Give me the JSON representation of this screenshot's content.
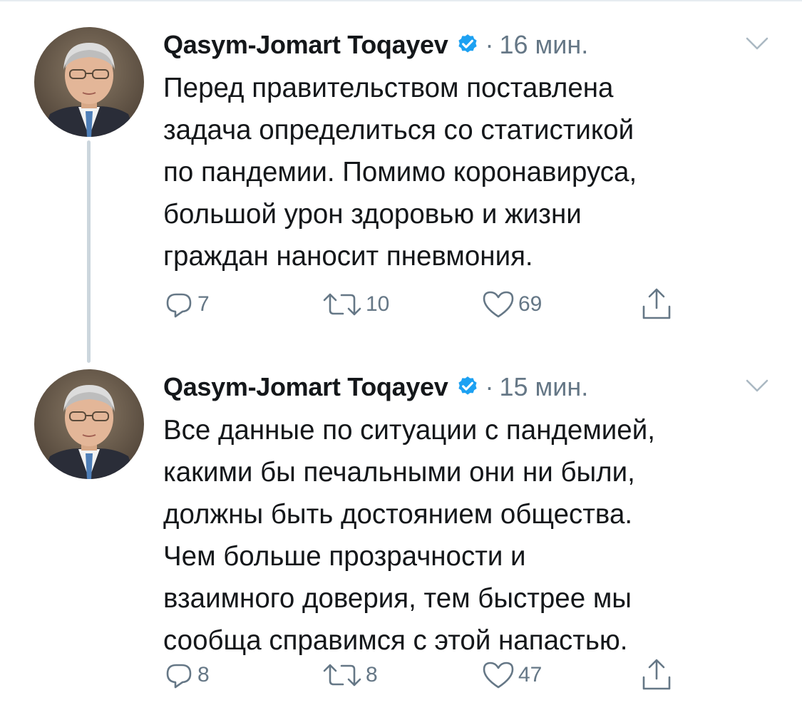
{
  "colors": {
    "text": "#14171a",
    "secondary": "#657786",
    "verified": "#1da1f2",
    "thread_line": "#ccd6dd"
  },
  "tweets": [
    {
      "author_name": "Qasym-Jomart Toqayev",
      "verified_icon": "verified-badge-icon",
      "separator": "·",
      "time": "16 мин.",
      "text": "Перед правительством поставлена\nзадача определиться со статистикой\nпо пандемии. Помимо коронавируса,\nбольшой урон здоровью и жизни\nграждан наносит пневмония.",
      "replies": "7",
      "retweets": "10",
      "likes": "69"
    },
    {
      "author_name": "Qasym-Jomart Toqayev",
      "verified_icon": "verified-badge-icon",
      "separator": "·",
      "time": "15 мин.",
      "text": "Все данные по ситуации с пандемией,\nкакими бы печальными они ни были,\nдолжны  быть достоянием общества.\nЧем больше прозрачности и\nвзаимного доверия, тем быстрее мы\nсообща справимся с этой напастью.",
      "replies": "8",
      "retweets": "8",
      "likes": "47"
    }
  ]
}
